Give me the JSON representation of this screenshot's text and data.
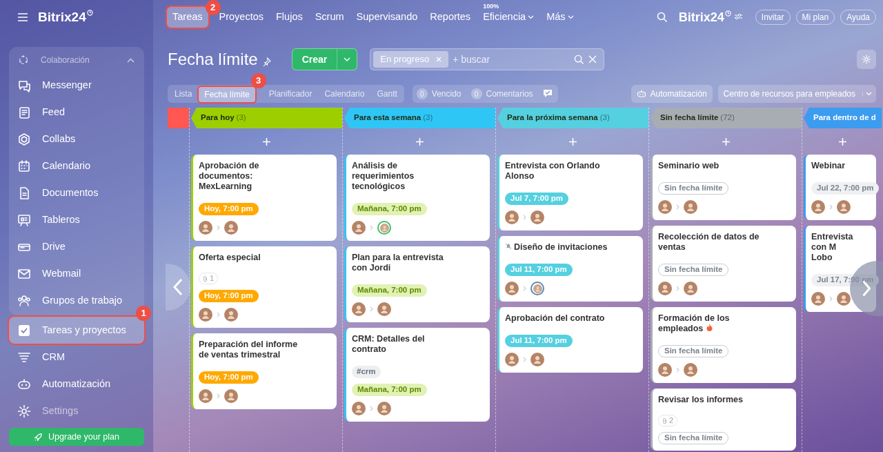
{
  "sidebar": {
    "logo": "Bitrix24",
    "group": {
      "label": "Colaboración",
      "expanded": true,
      "items": [
        {
          "label": "Messenger",
          "selected": false
        },
        {
          "label": "Feed",
          "selected": false
        },
        {
          "label": "Collabs",
          "selected": false
        },
        {
          "label": "Calendario",
          "selected": false
        },
        {
          "label": "Documentos",
          "selected": false
        },
        {
          "label": "Tableros",
          "selected": false
        },
        {
          "label": "Drive",
          "selected": false
        },
        {
          "label": "Webmail",
          "selected": false
        },
        {
          "label": "Grupos de trabajo",
          "selected": false
        }
      ]
    },
    "items": [
      {
        "label": "Tareas y proyectos",
        "selected": true,
        "callout": "1"
      },
      {
        "label": "CRM",
        "selected": false
      },
      {
        "label": "Automatización",
        "selected": false
      },
      {
        "label": "Settings",
        "selected": false,
        "dimmed": true
      }
    ],
    "upgrade_button": "Upgrade your plan"
  },
  "top_nav": [
    {
      "label": "Tareas",
      "selected": true,
      "callout": "2"
    },
    {
      "label": "Proyectos",
      "selected": false
    },
    {
      "label": "Flujos",
      "selected": false
    },
    {
      "label": "Scrum",
      "selected": false
    },
    {
      "label": "Supervisando",
      "selected": false
    },
    {
      "label": "Reportes",
      "selected": false
    },
    {
      "label": "Eficiencia",
      "selected": false,
      "badge": "100%",
      "dropdown": true
    },
    {
      "label": "Más",
      "selected": false,
      "dropdown": true
    }
  ],
  "header": {
    "logo": "Bitrix24",
    "buttons": [
      "Invitar",
      "Mi plan",
      "Ayuda"
    ]
  },
  "page": {
    "title": "Fecha límite",
    "create_button": "Crear",
    "filter_chip": "En progreso",
    "search_placeholder": "+ buscar"
  },
  "view_tabs": [
    {
      "label": "Lista",
      "selected": false
    },
    {
      "label": "Fecha límite",
      "selected": true,
      "callout": "3"
    },
    {
      "label": "Planificador",
      "selected": false
    },
    {
      "label": "Calendario",
      "selected": false
    },
    {
      "label": "Gantt",
      "selected": false
    }
  ],
  "counters": [
    {
      "count": "0",
      "label": "Vencido"
    },
    {
      "count": "0",
      "label": "Comentarios"
    }
  ],
  "automation_button": "Automatización",
  "resource_center": "Centro de recursos para empleados",
  "columns": [
    {
      "title": "Para hoy",
      "count": "(3)",
      "color": "#9dcf00",
      "cards": [
        {
          "title": "Aprobación de documentos: MexLearning",
          "deadline": {
            "text": "Hoy, 7:00 pm",
            "color": "#ffa900"
          },
          "show_people": true
        },
        {
          "title": "Oferta especial",
          "attachments": "1",
          "deadline": {
            "text": "Hoy, 7:00 pm",
            "color": "#ffa900"
          },
          "show_people": true
        },
        {
          "title": "Preparación del informe de ventas trimestral",
          "deadline": {
            "text": "Hoy, 7:00 pm",
            "color": "#ffa900"
          },
          "show_people": true
        }
      ]
    },
    {
      "title": "Para esta semana",
      "count": "(3)",
      "color": "#2fc6f6",
      "cards": [
        {
          "title": "Análisis de requerimientos tecnológicos",
          "deadline": {
            "text": "Mañana, 7:00 pm",
            "color": "#e2f1b4"
          },
          "show_people": true,
          "assignee_ring": {
            "color": "#3bc16a"
          }
        },
        {
          "title": "Plan para la entrevista con Jordi",
          "deadline": {
            "text": "Mañana, 7:00 pm",
            "color": "#e2f1b4"
          },
          "show_people": true
        },
        {
          "title": "CRM: Detalles del contrato",
          "tag": "#crm",
          "deadline": {
            "text": "Mañana, 7:00 pm",
            "color": "#e2f1b4"
          },
          "show_people": true
        }
      ]
    },
    {
      "title": "Para la próxima semana",
      "count": "(3)",
      "color": "#55d0e0",
      "cards": [
        {
          "title": "Entrevista con Orlando Alonso",
          "deadline": {
            "text": "Jul 7, 7:00 pm",
            "color": "#55d0e0"
          },
          "show_people": true
        },
        {
          "title": "Diseño de invitaciones",
          "muted": true,
          "deadline": {
            "text": "Jul 11, 7:00 pm",
            "color": "#55d0e0"
          },
          "show_people": true,
          "assignee_ring": {
            "color": "#5a88b5"
          }
        },
        {
          "title": "Aprobación del contrato",
          "deadline": {
            "text": "Jul 11, 7:00 pm",
            "color": "#55d0e0"
          },
          "show_people": true
        }
      ]
    },
    {
      "title": "Sin fecha límite",
      "count": "(72)",
      "color": "#a8adb4",
      "cards": [
        {
          "title": "Seminario web",
          "deadline": {
            "text": "Sin fecha límite",
            "color": "#ffffff"
          },
          "show_people": true
        },
        {
          "title": "Recolección de datos de ventas",
          "deadline": {
            "text": "Sin fecha límite",
            "color": "#ffffff"
          },
          "show_people": true
        },
        {
          "title": "Formación de los empleados",
          "hot": true,
          "deadline": {
            "text": "Sin fecha límite",
            "color": "#ffffff"
          },
          "show_people": true
        },
        {
          "title": "Revisar los informes",
          "attachments": "2",
          "deadline": {
            "text": "Sin fecha límite",
            "color": "#ffffff"
          },
          "show_people": false
        }
      ]
    },
    {
      "title": "Para dentro de d",
      "color": "#3b9cf0",
      "cards": [
        {
          "title": "Webinar",
          "deadline": {
            "text": "Jul 22, 7:00 pm",
            "color": "#eef0f2"
          },
          "show_people": true
        },
        {
          "title": "Entrevista con M\nLobo",
          "deadline": {
            "text": "Jul 17, 7:00 pm",
            "color": "#eef0f2"
          },
          "show_people": true
        }
      ]
    }
  ]
}
